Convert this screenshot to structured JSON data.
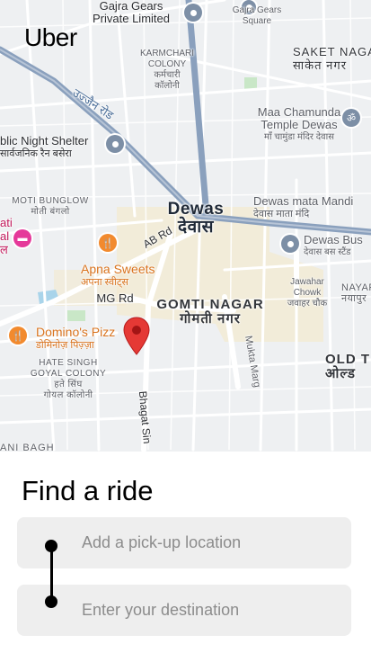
{
  "app": {
    "brand": "Uber"
  },
  "map": {
    "labels": {
      "gajra_gears_pvt": [
        "Gajra Gears",
        "Private Limited"
      ],
      "gajra_gears_sq": [
        "Gajra Gears",
        "Square"
      ],
      "karmchari": [
        "KARMCHARI",
        "COLONY",
        "कर्मचारी",
        "कॉलोनी"
      ],
      "saket": [
        "SAKET NAGA",
        "साकेत नगर"
      ],
      "ujjain_road": "उज्जैन रोड",
      "chamunda": [
        "Maa Chamunda",
        "Temple Dewas",
        "माँ चामुंडा मंदिर देवास"
      ],
      "night_shelter": [
        "blic Night Shelter",
        "सार्वजनिक रैन बसेरा"
      ],
      "moti_bunglow": [
        "MOTI BUNGLOW",
        "मोती बंगलो"
      ],
      "dewas": [
        "Dewas",
        "देवास"
      ],
      "dewas_mandi": [
        "Dewas mata Mandi",
        "देवास माता मंदि"
      ],
      "ab_rd": "AB Rd",
      "dewas_bus": [
        "Dewas Bus",
        "देवास बस स्टैंड"
      ],
      "left_hotel": [
        "ati",
        "al",
        "ल"
      ],
      "apna_sweets": [
        "Apna Sweets",
        "अपना स्वीट्स"
      ],
      "jawahar": [
        "Jawahar",
        "Chowk",
        "जवाहर चौक"
      ],
      "nayapura": [
        "NAYAPUR",
        "नयापुर"
      ],
      "mg_rd": "MG Rd",
      "gomti": [
        "GOMTI NAGAR",
        "गोमती नगर"
      ],
      "dominos": [
        "Domino's Pizz",
        "डोमिनोज़ पिज़्ज़ा"
      ],
      "mukta_marg": "Mukta Marg",
      "old_t": [
        "OLD T",
        "ओल्ड"
      ],
      "hate_singh": [
        "HATE SINGH",
        "GOYAL COLONY",
        "हते सिंघ",
        "गोयल कॉलोनी"
      ],
      "bhagat_sin": "Bhagat Sin",
      "ani_bagh": "ANI BAGH"
    },
    "colors": {
      "background": "#eef0f2",
      "major_road": "#8aa0bd",
      "road": "#ffffff",
      "highlight_area": "#f3e9cf",
      "water": "#a9d4ea",
      "pin": "#e53935"
    }
  },
  "ride": {
    "title": "Find a ride",
    "pickup_placeholder": "Add a pick-up location",
    "pickup_value": "",
    "destination_placeholder": "Enter your destination",
    "destination_value": ""
  }
}
